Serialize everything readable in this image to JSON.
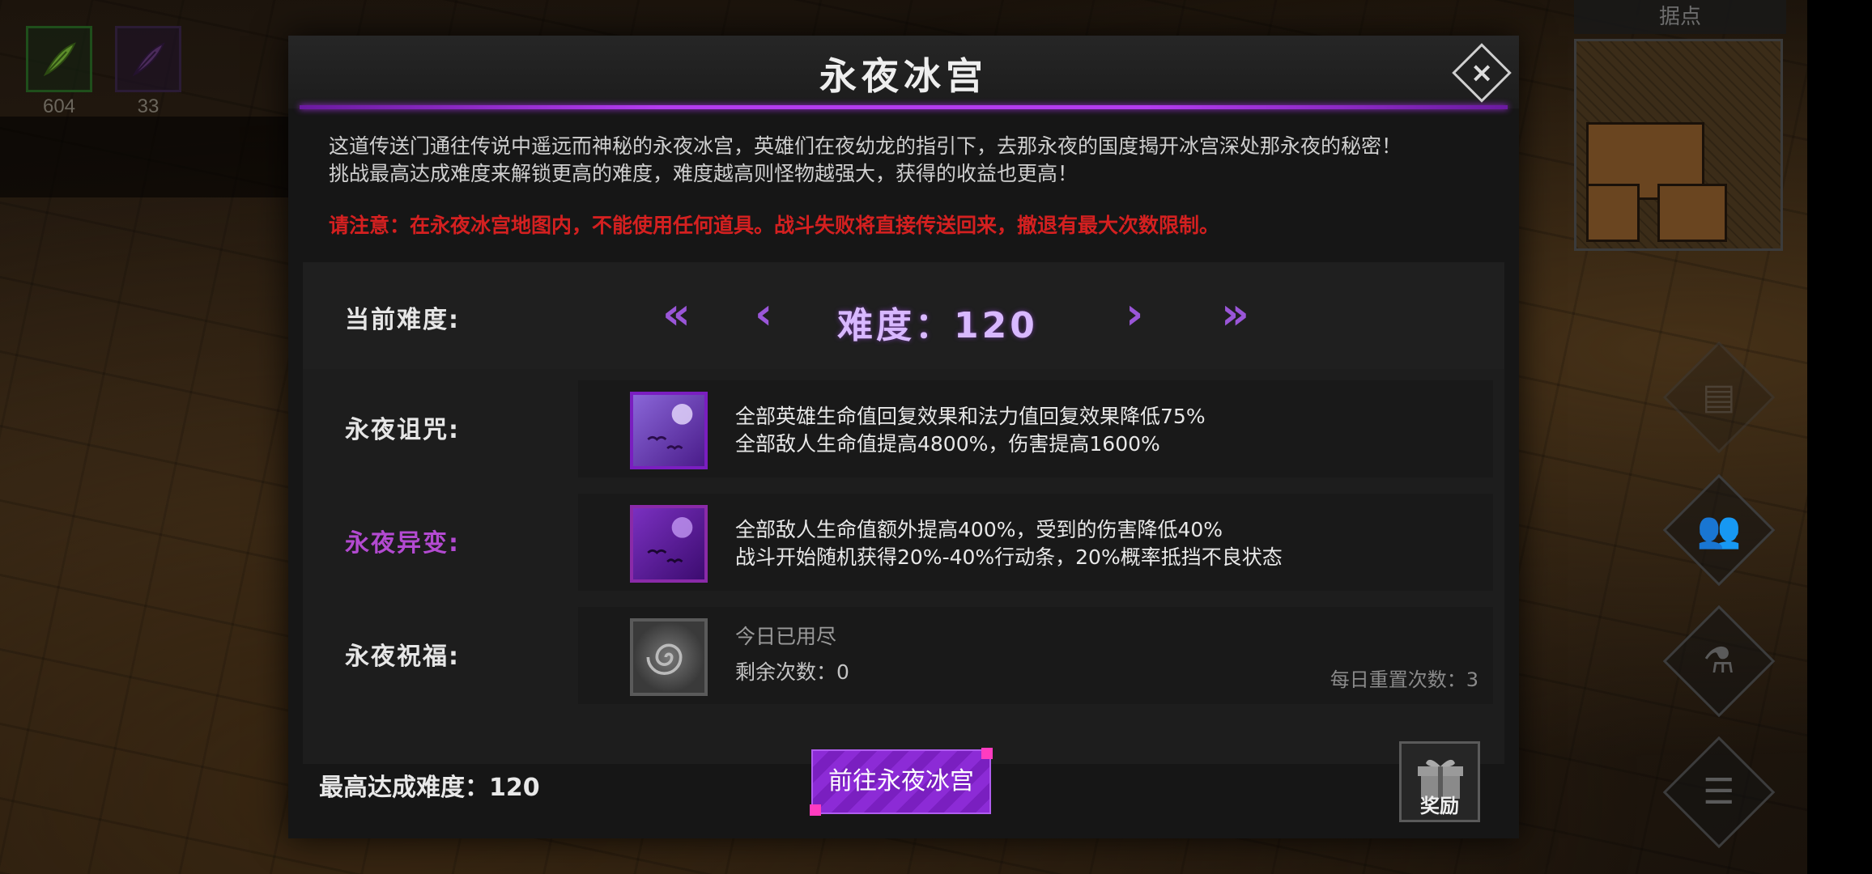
{
  "items": [
    {
      "icon": "feather-icon",
      "count": "604"
    },
    {
      "icon": "shadow-feather-icon",
      "count": "33"
    }
  ],
  "minimap": {
    "title": "据点"
  },
  "side_buttons": [
    "scroll-icon",
    "heroes-icon",
    "potion-icon",
    "menu-list-icon"
  ],
  "modal": {
    "title": "永夜冰宫",
    "close_label": "×",
    "description": [
      "这道传送门通往传说中遥远而神秘的永夜冰宫，英雄们在夜幼龙的指引下，去那永夜的国度揭开冰宫深处那永夜的秘密！",
      "挑战最高达成难度来解锁更高的难度，难度越高则怪物越强大，获得的收益也更高！"
    ],
    "warning": "请注意：在永夜冰宫地图内，不能使用任何道具。战斗失败将直接传送回来，撤退有最大次数限制。",
    "difficulty": {
      "label": "当前难度:",
      "value_text": "难度：120",
      "value": 120
    },
    "curse": {
      "label": "永夜诅咒:",
      "lines": [
        "全部英雄生命值回复效果和法力值回复效果降低75%",
        "全部敌人生命值提高4800%，伤害提高1600%"
      ]
    },
    "mutation": {
      "label": "永夜异变:",
      "lines": [
        "全部敌人生命值额外提高400%，受到的伤害降低40%",
        "战斗开始随机获得20%-40%行动条，20%概率抵挡不良状态"
      ]
    },
    "blessing": {
      "label": "永夜祝福:",
      "status": "今日已用尽",
      "remaining": "剩余次数：0",
      "daily_reset": "每日重置次数：3"
    },
    "max_difficulty": "最高达成难度：120",
    "go_button": "前往永夜冰宫",
    "reward_button": "奖励"
  },
  "colors": {
    "accent_purple": "#b43cf0",
    "warning_red": "#d42020",
    "mutation_label": "#b34ad1"
  }
}
